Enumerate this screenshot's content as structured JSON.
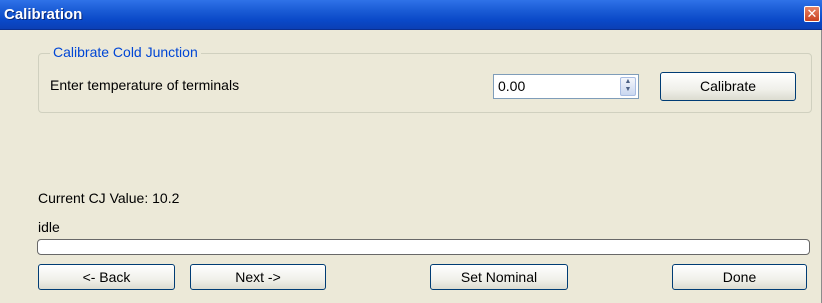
{
  "window": {
    "title": "Calibration",
    "close_glyph": "✕"
  },
  "group": {
    "title": "Calibrate Cold Junction",
    "prompt": "Enter temperature of terminals",
    "temperature_value": "0.00",
    "calibrate_label": "Calibrate"
  },
  "status": {
    "cj_label": "Current CJ Value: 10.2",
    "state": "idle",
    "progress": 0
  },
  "footer": {
    "back_label": "<- Back",
    "next_label": "Next ->",
    "set_nominal_label": "Set Nominal",
    "done_label": "Done"
  },
  "icons": {
    "close": "close-icon",
    "spinner": "up-down-arrows-icon"
  }
}
